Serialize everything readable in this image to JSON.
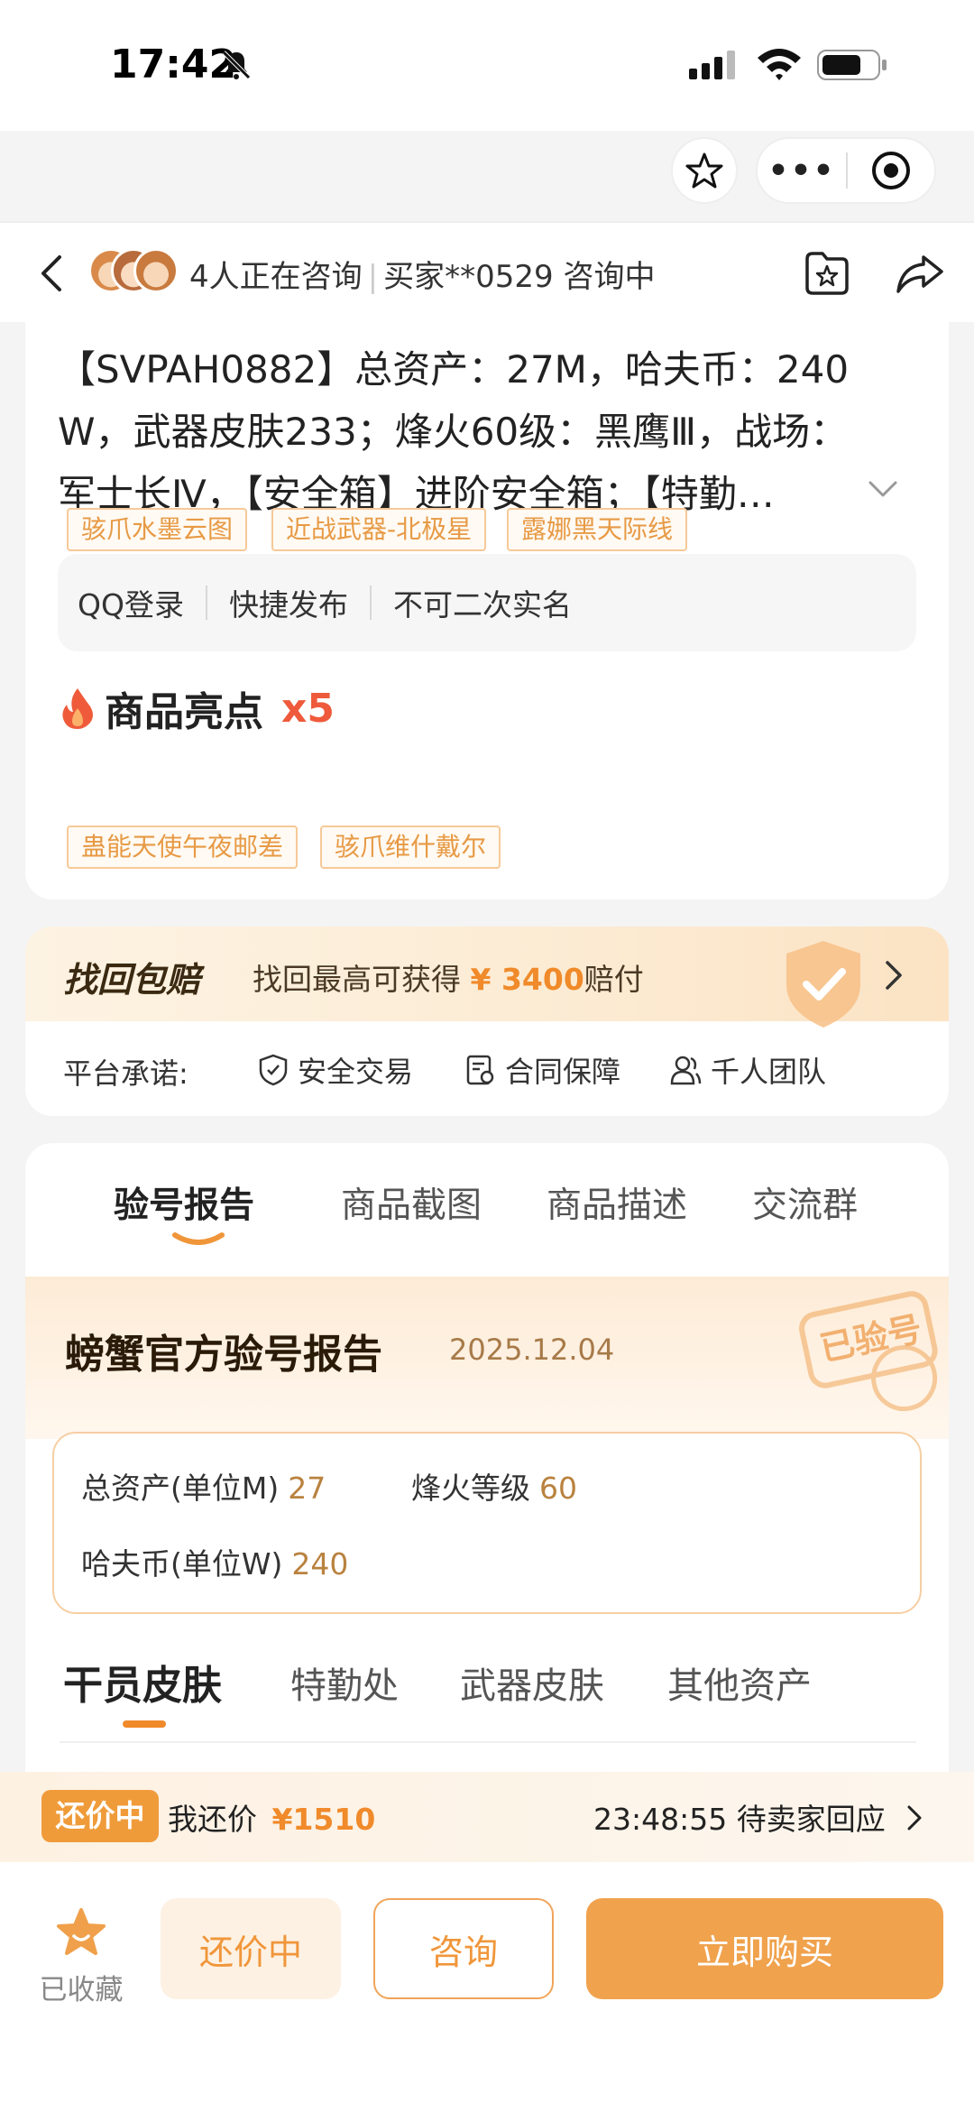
{
  "status_bar": {
    "time": "17:42",
    "icons": [
      "bell-off-icon",
      "signal-icon",
      "wifi-icon",
      "battery-icon"
    ]
  },
  "capsule": {
    "more_label": "•••",
    "icons": [
      "star-icon",
      "more-icon",
      "target-icon"
    ]
  },
  "navbar": {
    "consult_count_text": "4人正在咨询",
    "buyer_text": "买家**0529 咨询中"
  },
  "product": {
    "title_lines": [
      "【SVPAH0882】总资产：27M，哈夫币：240",
      "W，武器皮肤233；烽火60级：黑鹰Ⅲ，战场：",
      "军士长Ⅳ，【安全箱】进阶安全箱；【特勤…"
    ],
    "tags": [
      "QQ登录",
      "快捷发布",
      "不可二次实名"
    ],
    "highlights_title": "商品亮点",
    "highlights_count": "x5",
    "highlights": [
      "骇爪水墨云图",
      "近战武器-北极星",
      "露娜黑天际线",
      "蛊能天使午夜邮差",
      "骇爪维什戴尔"
    ]
  },
  "guarantee": {
    "title": "找回包赔",
    "desc_prefix": "找回最高可获得",
    "amount": "¥ 3400",
    "desc_suffix": "赔付",
    "promise_label": "平台承诺:",
    "promises": [
      "安全交易",
      "合同保障",
      "千人团队"
    ]
  },
  "tabs": {
    "items": [
      "验号报告",
      "商品截图",
      "商品描述",
      "交流群"
    ],
    "active": "验号报告"
  },
  "report": {
    "title": "螃蟹官方验号报告",
    "date": "2025.12.04",
    "stamp_text": "已验号",
    "stats": [
      {
        "label": "总资产(单位M)",
        "value": "27"
      },
      {
        "label": "烽火等级",
        "value": "60"
      },
      {
        "label": "哈夫币(单位W)",
        "value": "240"
      }
    ],
    "sub_tabs": [
      "干员皮肤",
      "特勤处",
      "武器皮肤",
      "其他资产"
    ]
  },
  "bargain": {
    "tag": "还价中",
    "my_offer_label": "我还价",
    "my_offer_price": "¥1510",
    "countdown": "23:48:55",
    "status": "待卖家回应"
  },
  "bottom": {
    "collect_label": "已收藏",
    "bargain_button": "还价中",
    "consult_button": "咨询",
    "buy_button": "立即购买"
  },
  "colors": {
    "accent": "#f0a24d",
    "highlight_red": "#ee5a3b",
    "chip_text": "#e79a45"
  }
}
